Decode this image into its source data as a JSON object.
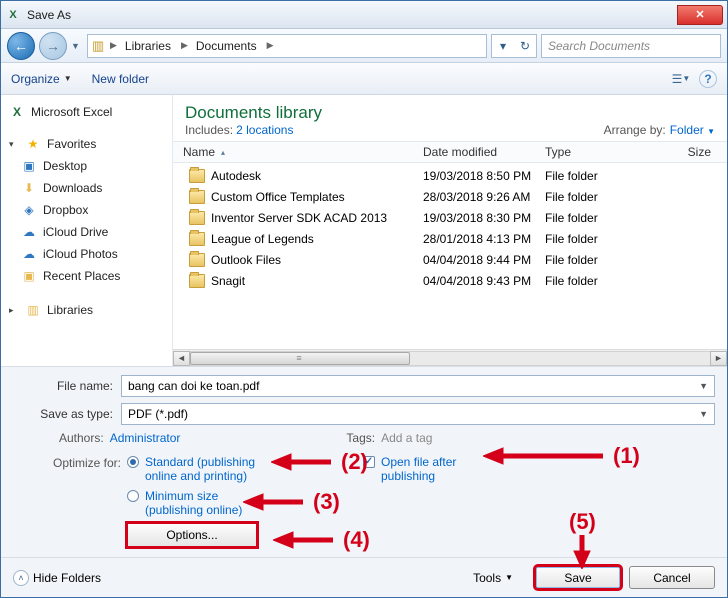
{
  "window": {
    "title": "Save As"
  },
  "breadcrumb": {
    "seg1": "Libraries",
    "seg2": "Documents"
  },
  "search": {
    "placeholder": "Search Documents"
  },
  "toolbar": {
    "organize": "Organize",
    "newfolder": "New folder"
  },
  "sidebar": {
    "ms_excel": "Microsoft Excel",
    "favorites": "Favorites",
    "desktop": "Desktop",
    "downloads": "Downloads",
    "dropbox": "Dropbox",
    "icloud_drive": "iCloud Drive",
    "icloud_photos": "iCloud Photos",
    "recent": "Recent Places",
    "libraries": "Libraries"
  },
  "library": {
    "title": "Documents library",
    "includes_label": "Includes:",
    "includes_link": "2 locations",
    "arrange_label": "Arrange by:",
    "arrange_value": "Folder"
  },
  "columns": {
    "name": "Name",
    "date": "Date modified",
    "type": "Type",
    "size": "Size"
  },
  "rows": [
    {
      "name": "Autodesk",
      "date": "19/03/2018 8:50 PM",
      "type": "File folder"
    },
    {
      "name": "Custom Office Templates",
      "date": "28/03/2018 9:26 AM",
      "type": "File folder"
    },
    {
      "name": "Inventor Server SDK ACAD 2013",
      "date": "19/03/2018 8:30 PM",
      "type": "File folder"
    },
    {
      "name": "League of Legends",
      "date": "28/01/2018 4:13 PM",
      "type": "File folder"
    },
    {
      "name": "Outlook Files",
      "date": "04/04/2018 9:44 PM",
      "type": "File folder"
    },
    {
      "name": "Snagit",
      "date": "04/04/2018 9:43 PM",
      "type": "File folder"
    }
  ],
  "form": {
    "filename_label": "File name:",
    "filename_value": "bang can doi ke toan.pdf",
    "type_label": "Save as type:",
    "type_value": "PDF (*.pdf)",
    "authors_label": "Authors:",
    "authors_value": "Administrator",
    "tags_label": "Tags:",
    "tags_value": "Add a tag",
    "optimize_label": "Optimize for:",
    "opt_standard": "Standard (publishing\nonline and printing)",
    "opt_min": "Minimum size\n(publishing online)",
    "options_btn": "Options...",
    "open_after": "Open file after\npublishing"
  },
  "footer": {
    "hide": "Hide Folders",
    "tools": "Tools",
    "save": "Save",
    "cancel": "Cancel"
  },
  "anno": {
    "a1": "(1)",
    "a2": "(2)",
    "a3": "(3)",
    "a4": "(4)",
    "a5": "(5)"
  }
}
